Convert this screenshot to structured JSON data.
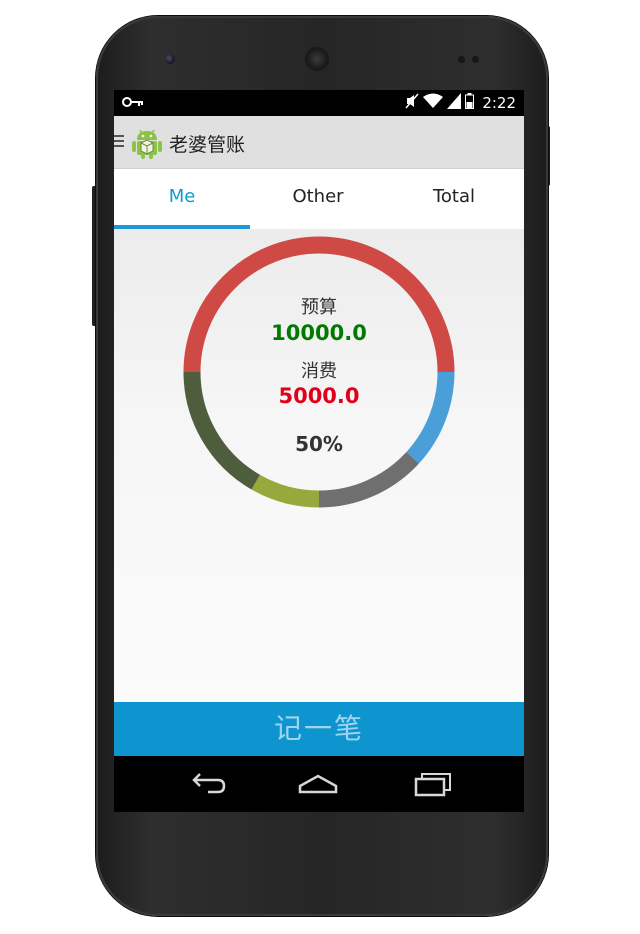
{
  "status_bar": {
    "time": "2:22",
    "icons": [
      "key-icon",
      "mute-icon",
      "wifi-icon",
      "signal-icon",
      "battery-icon"
    ]
  },
  "action_bar": {
    "title": "老婆管账",
    "icons": [
      "menu-icon",
      "android-app-icon"
    ]
  },
  "tabs": [
    {
      "label": "Me",
      "active": true
    },
    {
      "label": "Other",
      "active": false
    },
    {
      "label": "Total",
      "active": false
    }
  ],
  "summary": {
    "budget_label": "预算",
    "budget_value": "10000.0",
    "spent_label": "消费",
    "spent_value": "5000.0",
    "percent": "50%"
  },
  "ring_chart": {
    "segments": [
      {
        "color": "#cf4a45",
        "fraction": 0.5
      },
      {
        "color": "#4a9fd8",
        "fraction": 0.118
      },
      {
        "color": "#6f6f6f",
        "fraction": 0.132
      },
      {
        "color": "#97a93c",
        "fraction": 0.083
      },
      {
        "color": "#4e5e3c",
        "fraction": 0.167
      }
    ]
  },
  "record_button": {
    "label": "记一笔"
  },
  "nav_bar": {
    "icons": [
      "back-icon",
      "home-icon",
      "recents-icon"
    ]
  },
  "colors": {
    "accent": "#1a9ad6",
    "budget_green": "#007a00",
    "spent_red": "#e0001b"
  }
}
